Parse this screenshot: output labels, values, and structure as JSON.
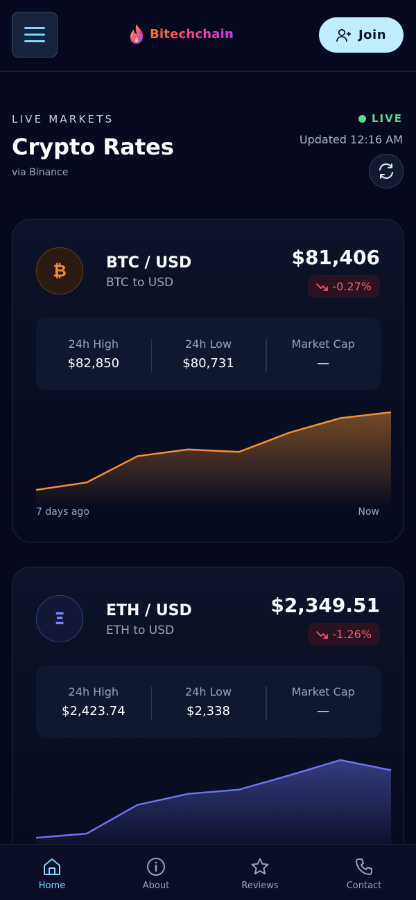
{
  "header": {
    "brand_name": "Bitechchain",
    "join_label": "Join"
  },
  "section": {
    "eyebrow": "LIVE MARKETS",
    "title": "Crypto Rates",
    "source": "via Binance",
    "live_label": "LIVE",
    "updated": "Updated 12:16 AM"
  },
  "cards": [
    {
      "symbol": "BTC",
      "icon_glyph": "₿",
      "pair": "BTC / USD",
      "subtitle": "BTC to USD",
      "price": "$81,406",
      "change": "-0.27%",
      "stats": [
        {
          "label": "24h High",
          "value": "$82,850"
        },
        {
          "label": "24h Low",
          "value": "$80,731"
        },
        {
          "label": "Market Cap",
          "value": "—"
        }
      ],
      "axis_start": "7 days ago",
      "axis_end": "Now",
      "accent": "#f5922e",
      "trend": [
        0.08,
        0.17,
        0.48,
        0.56,
        0.53,
        0.76,
        0.93,
        1.0
      ]
    },
    {
      "symbol": "ETH",
      "icon_glyph": "Ξ",
      "pair": "ETH / USD",
      "subtitle": "ETH to USD",
      "price": "$2,349.51",
      "change": "-1.26%",
      "stats": [
        {
          "label": "24h High",
          "value": "$2,423.74"
        },
        {
          "label": "24h Low",
          "value": "$2,338"
        },
        {
          "label": "Market Cap",
          "value": "—"
        }
      ],
      "accent": "#6b73f2",
      "trend": [
        0.08,
        0.13,
        0.47,
        0.6,
        0.65,
        0.82,
        1.0,
        0.88
      ]
    }
  ],
  "nav": [
    {
      "label": "Home",
      "icon": "home-icon",
      "active": true
    },
    {
      "label": "About",
      "icon": "info-icon",
      "active": false
    },
    {
      "label": "Reviews",
      "icon": "star-icon",
      "active": false
    },
    {
      "label": "Contact",
      "icon": "phone-icon",
      "active": false
    }
  ]
}
